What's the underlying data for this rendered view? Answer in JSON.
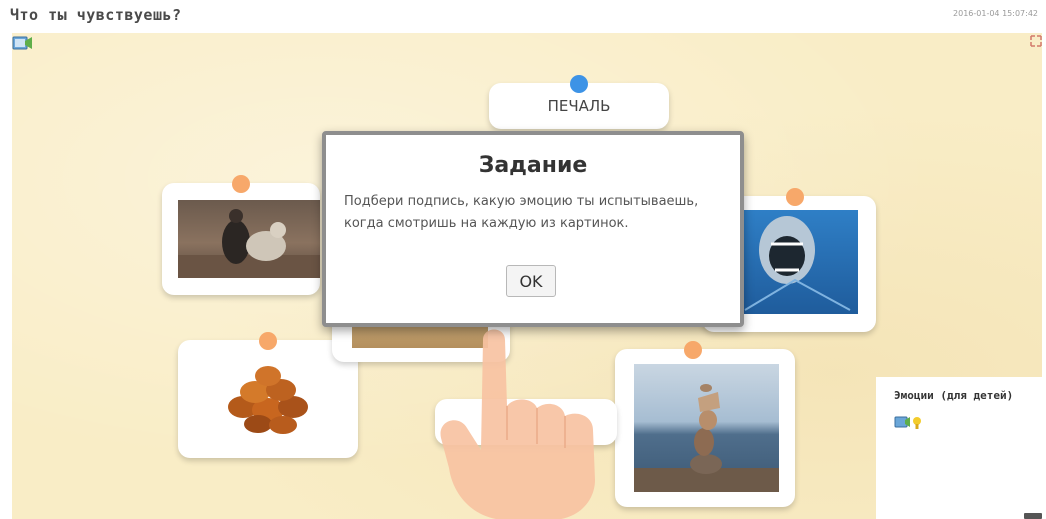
{
  "header": {
    "title": "Что ты чувствуешь?",
    "timestamp": "2016-01-04 15:07:42"
  },
  "stage": {
    "cards": [
      {
        "type": "label",
        "text": "ПЕЧАЛЬ",
        "pin": "blue"
      },
      {
        "type": "photo",
        "subject": "person-hugging-dog",
        "pin": "orange"
      },
      {
        "type": "photo",
        "subject": "shark",
        "pin": "orange"
      },
      {
        "type": "photo",
        "subject": "pile-of-bagels",
        "pin": "orange"
      },
      {
        "type": "photo",
        "subject": "stacked-stones-by-sea",
        "pin": "orange"
      },
      {
        "type": "photo",
        "subject": "beach-runner",
        "pin": "none"
      },
      {
        "type": "label",
        "text": "",
        "pin": "none"
      }
    ],
    "dialog": {
      "title": "Задание",
      "text": "Подбери подпись, какую эмоцию ты испытываешь, когда смотришь на каждую из картинок.",
      "ok_label": "OK"
    }
  },
  "side_panel": {
    "title": "Эмоции (для детей)"
  },
  "colors": {
    "stage_background": "#f9edc6",
    "pin_orange": "#f7a86a",
    "pin_blue": "#3d93e6",
    "dialog_border": "#8e8e8e"
  },
  "icons": [
    "help-icon",
    "fullscreen-icon",
    "side-app-icons"
  ]
}
